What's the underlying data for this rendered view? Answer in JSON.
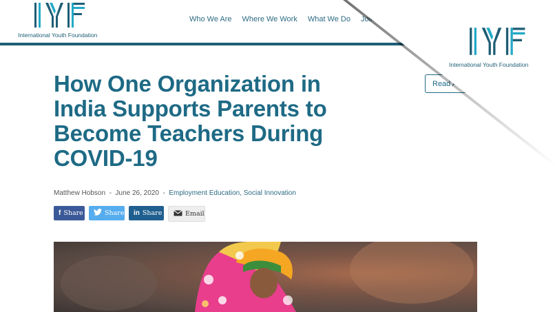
{
  "brand": {
    "logo_letters": "IYF",
    "name": "International Youth Foundation",
    "primary_color": "#1e5d75",
    "accent_color": "#23a9c6"
  },
  "nav": {
    "items": [
      "Who We Are",
      "Where We Work",
      "What We Do",
      "Join U"
    ]
  },
  "article": {
    "title": "How One Organization in India Supports Parents to Become Teachers During COVID-19",
    "author": "Matthew Hobson",
    "separator": "-",
    "date": "June 26, 2020",
    "categories": "Employment Education, Social Innovation",
    "read_button": "Read Al"
  },
  "share": {
    "facebook": {
      "label": "Share",
      "icon": "facebook-icon",
      "color": "#3b5998"
    },
    "twitter": {
      "label": "Share",
      "icon": "twitter-icon",
      "color": "#55acee"
    },
    "linkedin": {
      "label": "Share",
      "icon": "linkedin-icon",
      "color": "#1f5f8f"
    },
    "email": {
      "label": "Email",
      "icon": "envelope-icon",
      "color": "#eeeeee"
    }
  },
  "hero_image": {
    "subject": "photo-woman-in-pink-sari"
  }
}
